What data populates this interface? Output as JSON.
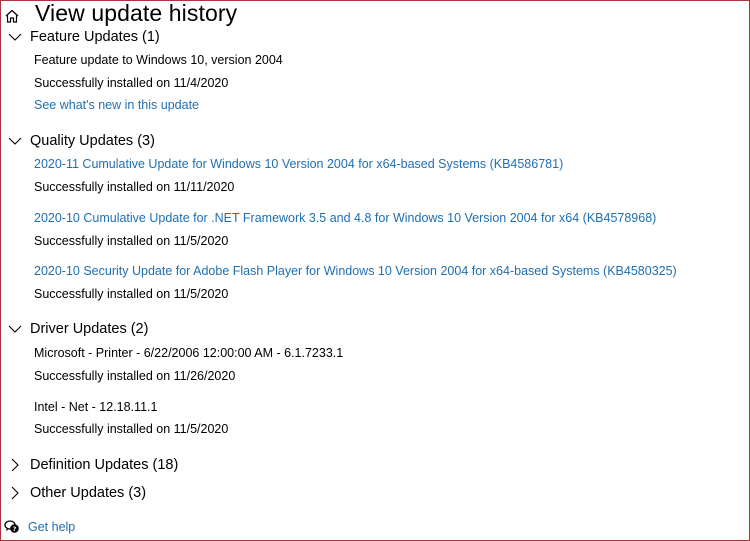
{
  "header": {
    "title": "View update history",
    "home_icon": "home-icon"
  },
  "colors": {
    "link": "#1f6fb2",
    "frame_border": "#a8343c"
  },
  "groups": [
    {
      "title": "Feature Updates (1)",
      "expanded": true,
      "icon": "chevron-down-icon",
      "items": [
        {
          "name": "Feature update to Windows 10, version 2004",
          "is_link": false,
          "status": "Successfully installed on 11/4/2020",
          "extra_link": "See what's new in this update"
        }
      ]
    },
    {
      "title": "Quality Updates (3)",
      "expanded": true,
      "icon": "chevron-down-icon",
      "items": [
        {
          "name": "2020-11 Cumulative Update for Windows 10 Version 2004 for x64-based Systems (KB4586781)",
          "is_link": true,
          "status": "Successfully installed on 11/11/2020"
        },
        {
          "name": "2020-10 Cumulative Update for .NET Framework 3.5 and 4.8 for Windows 10 Version 2004 for x64 (KB4578968)",
          "is_link": true,
          "status": "Successfully installed on 11/5/2020"
        },
        {
          "name": "2020-10 Security Update for Adobe Flash Player for Windows 10 Version 2004 for x64-based Systems (KB4580325)",
          "is_link": true,
          "status": "Successfully installed on 11/5/2020"
        }
      ]
    },
    {
      "title": "Driver Updates (2)",
      "expanded": true,
      "icon": "chevron-down-icon",
      "items": [
        {
          "name": "Microsoft - Printer - 6/22/2006 12:00:00 AM - 6.1.7233.1",
          "is_link": false,
          "status": "Successfully installed on 11/26/2020"
        },
        {
          "name": "Intel - Net - 12.18.11.1",
          "is_link": false,
          "status": "Successfully installed on 11/5/2020"
        }
      ]
    },
    {
      "title": "Definition Updates (18)",
      "expanded": false,
      "icon": "chevron-right-icon",
      "items": []
    },
    {
      "title": "Other Updates (3)",
      "expanded": false,
      "icon": "chevron-right-icon",
      "items": []
    }
  ],
  "footer": {
    "help_label": "Get help",
    "help_icon": "help-chat-icon"
  }
}
